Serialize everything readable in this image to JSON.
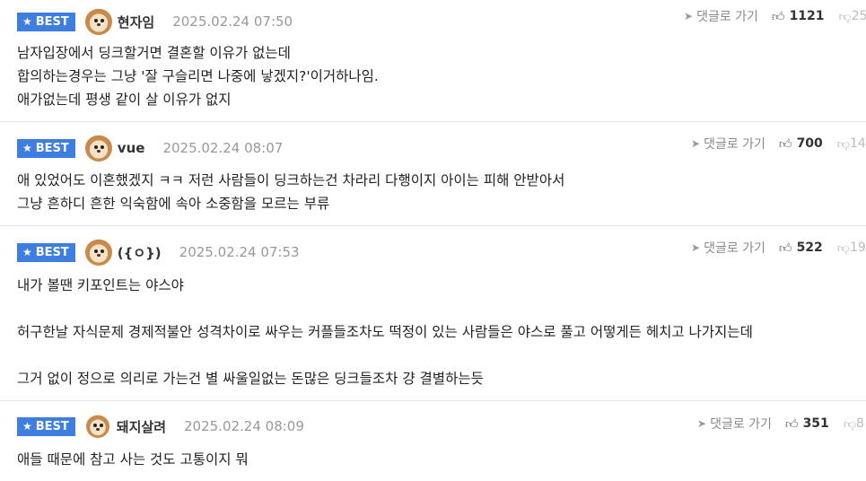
{
  "best_label": "BEST",
  "reply_label": "댓글로 가기",
  "comments": [
    {
      "nick": "현자임",
      "date": "2025.02.24 07:50",
      "likes": "1121",
      "dislikes": "25",
      "lines": [
        "남자입장에서 딩크할거면 결혼할 이유가 없는데",
        "합의하는경우는 그냥 '잘 구슬리면 나중에 낳겠지?'이거하나임.",
        "애가없는데 평생 같이 살 이유가 없지"
      ]
    },
    {
      "nick": "vue",
      "date": "2025.02.24 08:07",
      "likes": "700",
      "dislikes": "14",
      "lines": [
        "애 있었어도 이혼했겠지 ㅋㅋ 저런 사람들이 딩크하는건 차라리 다행이지 아이는 피해 안받아서",
        "그냥 흔하디 흔한 익숙함에 속아 소중함을 모르는 부류"
      ]
    },
    {
      "nick": "({ㅇ})",
      "date": "2025.02.24 07:53",
      "likes": "522",
      "dislikes": "19",
      "lines": [
        "내가 볼땐 키포인트는 야스야",
        "허구한날 자식문제 경제적불안 성격차이로 싸우는 커플들조차도 떡정이 있는 사람들은 야스로 풀고 어떻게든 헤치고 나가지는데",
        "그거 없이 정으로 의리로 가는건 별 싸울일없는 돈많은 딩크들조차 걍 결별하는듯"
      ]
    },
    {
      "nick": "돼지살려",
      "date": "2025.02.24 08:09",
      "likes": "351",
      "dislikes": "8",
      "lines": [
        "애들 때문에 참고 사는 것도 고통이지 뭐"
      ]
    }
  ]
}
